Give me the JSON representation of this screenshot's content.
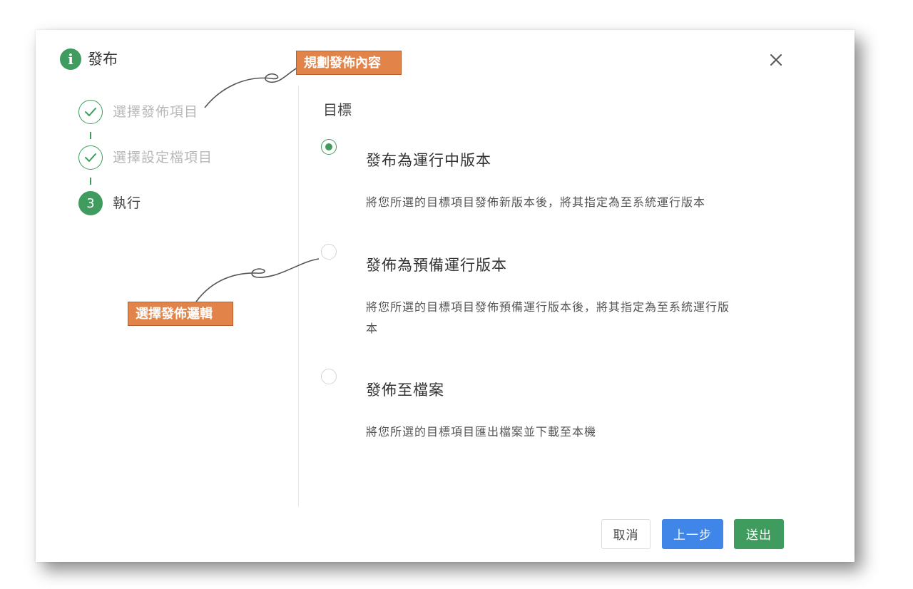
{
  "dialog": {
    "title": "發布",
    "info_icon_glyph": "i",
    "close_icon": "close-icon"
  },
  "steps": [
    {
      "label": "選擇發佈項目",
      "status": "completed",
      "icon": "check-icon"
    },
    {
      "label": "選擇設定檔項目",
      "status": "completed",
      "icon": "check-icon"
    },
    {
      "label": "執行",
      "status": "active",
      "number": "3"
    }
  ],
  "target": {
    "section_title": "目標",
    "selected_index": 0,
    "options": [
      {
        "title": "發布為運行中版本",
        "description": "將您所選的目標項目發佈新版本後，將其指定為至系統運行版本"
      },
      {
        "title": "發佈為預備運行版本",
        "description": "將您所選的目標項目發佈預備運行版本後，將其指定為至系統運行版本"
      },
      {
        "title": "發佈至檔案",
        "description": "將您所選的目標項目匯出檔案並下載至本機"
      }
    ]
  },
  "footer": {
    "cancel_label": "取消",
    "prev_label": "上一步",
    "submit_label": "送出"
  },
  "annotations": {
    "callout_content": "規劃發佈內容",
    "callout_logic": "選擇發佈邏輯"
  },
  "colors": {
    "primary_green": "#3f9b5e",
    "primary_blue": "#3f86e8",
    "callout_orange": "#e2834a",
    "muted_text": "#b8b8b8"
  }
}
